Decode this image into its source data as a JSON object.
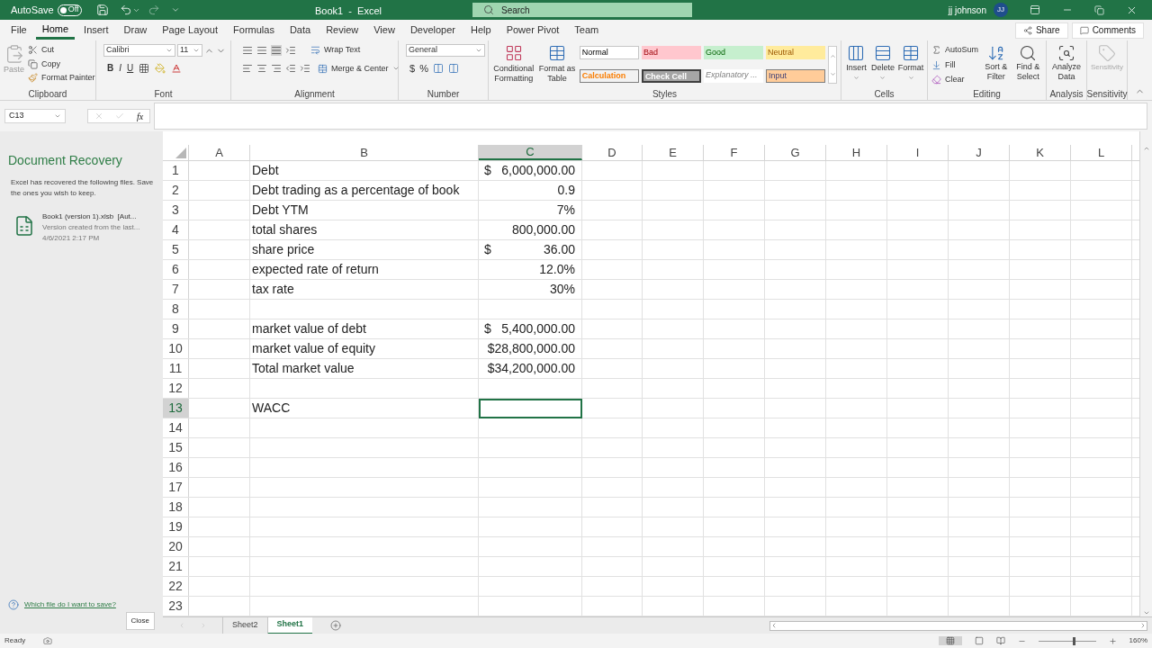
{
  "title_bar": {
    "autosave_label": "AutoSave",
    "autosave_toggle": {
      "label": "Off",
      "on": false
    },
    "title": "Book1  -  Excel",
    "search_placeholder": "Search",
    "user_name": "jj johnson",
    "user_initials": "JJ"
  },
  "menu_tabs": [
    {
      "label": "File",
      "selected": false
    },
    {
      "label": "Home",
      "selected": true
    },
    {
      "label": "Insert",
      "selected": false
    },
    {
      "label": "Draw",
      "selected": false
    },
    {
      "label": "Page Layout",
      "selected": false
    },
    {
      "label": "Formulas",
      "selected": false
    },
    {
      "label": "Data",
      "selected": false
    },
    {
      "label": "Review",
      "selected": false
    },
    {
      "label": "View",
      "selected": false
    },
    {
      "label": "Developer",
      "selected": false
    },
    {
      "label": "Help",
      "selected": false
    },
    {
      "label": "Power Pivot",
      "selected": false
    },
    {
      "label": "Team",
      "selected": false
    }
  ],
  "share": "Share",
  "comments": "Comments",
  "ribbon": {
    "clipboard": {
      "label": "Clipboard",
      "paste": "Paste",
      "cut": "Cut",
      "copy": "Copy",
      "format_painter": "Format Painter"
    },
    "font": {
      "label": "Font",
      "name": "Calibri",
      "size": "11",
      "bold": "B",
      "italic": "I",
      "underline": "U"
    },
    "alignment": {
      "label": "Alignment",
      "wrap": "Wrap Text",
      "merge": "Merge & Center"
    },
    "number": {
      "label": "Number",
      "format": "General",
      "currency": "$",
      "percent": "%"
    },
    "styles": {
      "label": "Styles",
      "conditional": "Conditional Formatting",
      "format_table": "Format as Table",
      "cell_styles": [
        {
          "label": "Normal",
          "kind": "normal"
        },
        {
          "label": "Bad",
          "kind": "bad"
        },
        {
          "label": "Good",
          "kind": "good"
        },
        {
          "label": "Neutral",
          "kind": "neutral"
        },
        {
          "label": "Calculation",
          "kind": "calculation"
        },
        {
          "label": "Check Cell",
          "kind": "check"
        },
        {
          "label": "Explanatory ...",
          "kind": "explanatory"
        },
        {
          "label": "Input",
          "kind": "input"
        }
      ]
    },
    "cells": {
      "label": "Cells",
      "buttons": [
        "Insert",
        "Delete",
        "Format"
      ]
    },
    "editing": {
      "label": "Editing",
      "autosum": "AutoSum",
      "fill": "Fill",
      "clear": "Clear",
      "sort": "Sort & Filter",
      "find": "Find & Select"
    },
    "analysis": {
      "label": "Analysis",
      "analyze": "Analyze Data"
    },
    "sensitivity": {
      "label": "Sensitivity",
      "button": "Sensitivity",
      "disabled": true
    }
  },
  "formula_bar": {
    "name_box": "C13",
    "fx": "fx"
  },
  "recovery": {
    "title": "Document Recovery",
    "message": "Excel has recovered the following files.  Save the ones you wish to keep.",
    "file": {
      "name": "Book1 (version 1).xlsb  [Aut...",
      "detail": "Version created from the last...",
      "date": "4/6/2021 2:17 PM"
    },
    "help_link": "Which file do I want to save?",
    "close": "Close"
  },
  "sheet": {
    "columns": [
      {
        "label": "A",
        "selected": false
      },
      {
        "label": "B",
        "selected": false
      },
      {
        "label": "C",
        "selected": true
      },
      {
        "label": "D",
        "selected": false
      },
      {
        "label": "E",
        "selected": false
      },
      {
        "label": "F",
        "selected": false
      },
      {
        "label": "G",
        "selected": false
      },
      {
        "label": "H",
        "selected": false
      },
      {
        "label": "I",
        "selected": false
      },
      {
        "label": "J",
        "selected": false
      },
      {
        "label": "K",
        "selected": false
      },
      {
        "label": "L",
        "selected": false
      }
    ],
    "rows": [
      {
        "number": "1",
        "label": "Debt",
        "currency": "$",
        "value": "6,000,000.00",
        "selected": false
      },
      {
        "number": "2",
        "label": "Debt trading as a percentage of book",
        "value": "0.9",
        "selected": false
      },
      {
        "number": "3",
        "label": "Debt YTM",
        "value": "7%",
        "selected": false
      },
      {
        "number": "4",
        "label": "total shares",
        "value": "800,000.00",
        "selected": false
      },
      {
        "number": "5",
        "label": "share price",
        "currency": "$",
        "value": "36.00",
        "selected": false
      },
      {
        "number": "6",
        "label": "expected rate of return",
        "value": "12.0%",
        "selected": false
      },
      {
        "number": "7",
        "label": "tax rate",
        "value": "30%",
        "selected": false
      },
      {
        "number": "8",
        "selected": false
      },
      {
        "number": "9",
        "label": "market value of debt",
        "currency": "$",
        "value": "5,400,000.00",
        "selected": false
      },
      {
        "number": "10",
        "label": "market value of equity",
        "value": "$28,800,000.00",
        "selected": false
      },
      {
        "number": "11",
        "label": "Total market value",
        "value": "$34,200,000.00",
        "selected": false
      },
      {
        "number": "12",
        "selected": false
      },
      {
        "number": "13",
        "label": "WACC",
        "selected": true
      },
      {
        "number": "14",
        "selected": false
      },
      {
        "number": "15",
        "selected": false
      },
      {
        "number": "16",
        "selected": false
      },
      {
        "number": "17",
        "selected": false
      },
      {
        "number": "18",
        "selected": false
      },
      {
        "number": "19",
        "selected": false
      },
      {
        "number": "20",
        "selected": false
      },
      {
        "number": "21",
        "selected": false
      },
      {
        "number": "22",
        "selected": false
      },
      {
        "number": "23",
        "selected": false
      }
    ]
  },
  "sheet_tabs": [
    {
      "label": "Sheet2",
      "selected": false
    },
    {
      "label": "Sheet1",
      "selected": true
    }
  ],
  "status_bar": {
    "status": "Ready",
    "zoom": "160%",
    "zoom_slider": {
      "level": 0.62
    }
  }
}
